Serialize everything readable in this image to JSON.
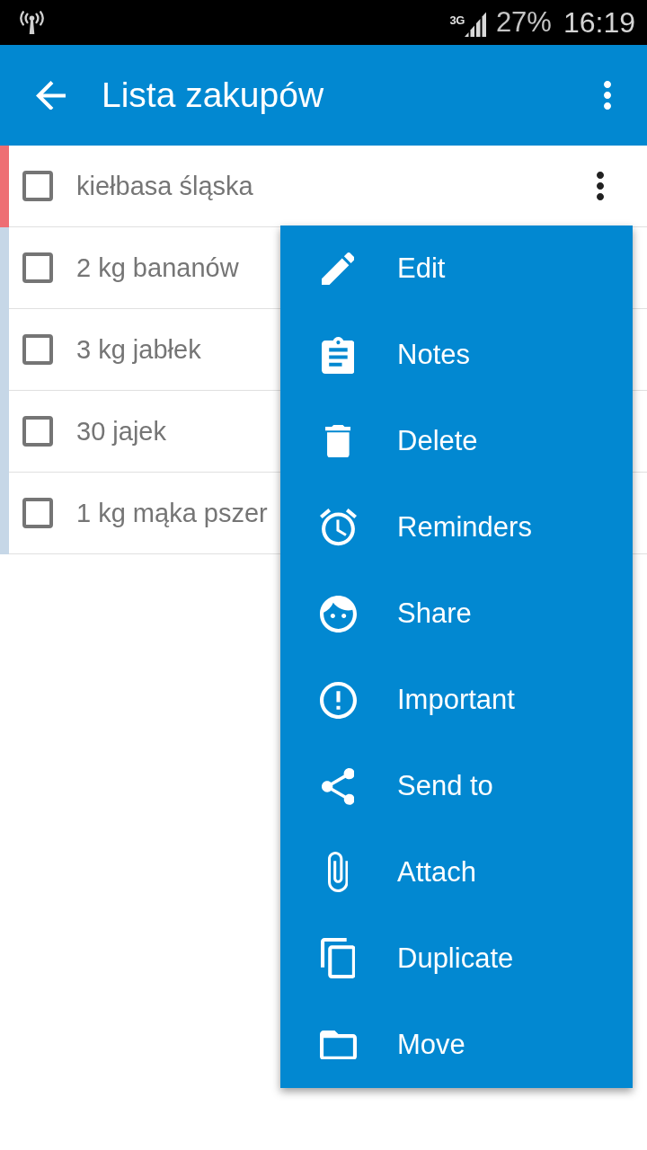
{
  "status_bar": {
    "network": "3G",
    "battery": "27%",
    "time": "16:19"
  },
  "app_bar": {
    "title": "Lista zakupów"
  },
  "items": [
    {
      "text": "kiełbasa śląska",
      "checked": false,
      "color": "#ee6e73",
      "menu_open": true
    },
    {
      "text": "2 kg bananów",
      "checked": false,
      "color": "#c6d7e7",
      "menu_open": false
    },
    {
      "text": "3 kg jabłek",
      "checked": false,
      "color": "#c6d7e7",
      "menu_open": false
    },
    {
      "text": "30 jajek",
      "checked": false,
      "color": "#c6d7e7",
      "menu_open": false
    },
    {
      "text": "1 kg mąka pszer",
      "checked": false,
      "color": "#c6d7e7",
      "menu_open": false
    }
  ],
  "context_menu": {
    "items": [
      {
        "label": "Edit"
      },
      {
        "label": "Notes"
      },
      {
        "label": "Delete"
      },
      {
        "label": "Reminders"
      },
      {
        "label": "Share"
      },
      {
        "label": "Important"
      },
      {
        "label": "Send to"
      },
      {
        "label": "Attach"
      },
      {
        "label": "Duplicate"
      },
      {
        "label": "Move"
      }
    ]
  }
}
